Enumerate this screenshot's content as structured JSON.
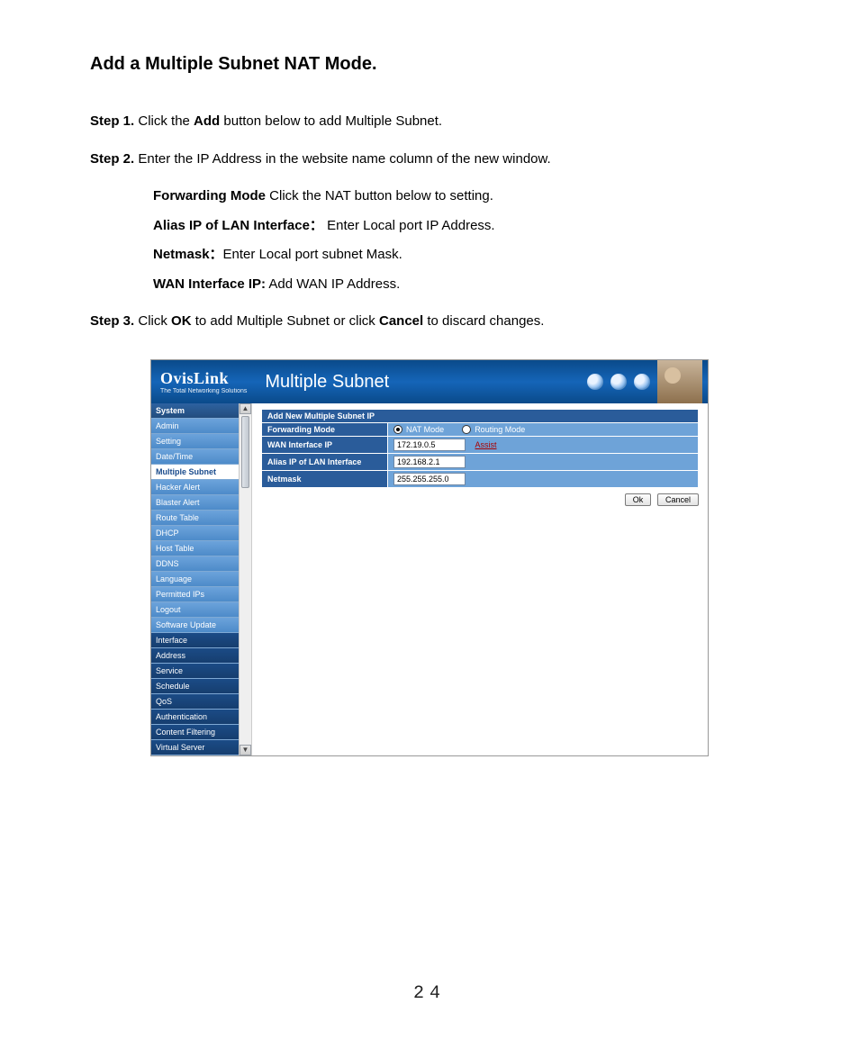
{
  "doc": {
    "title": "Add a Multiple Subnet NAT Mode.",
    "step1_label": "Step 1.",
    "step1_pre": " Click the ",
    "step1_bold": "Add",
    "step1_post": " button below to add Multiple Subnet.",
    "step2_label": "Step 2.",
    "step2_text": " Enter the IP Address in the website name column of the new window.",
    "sub_fwd_b": "Forwarding Mode",
    "sub_fwd_t": " Click the NAT button below to setting.",
    "sub_alias_b": "Alias IP of LAN Interface：",
    "sub_alias_t": "   Enter Local port IP Address.",
    "sub_net_b": "Netmask：",
    "sub_net_t": "Enter Local port subnet Mask.",
    "sub_wan_b": "WAN Interface IP:",
    "sub_wan_t": " Add WAN IP Address.",
    "step3_label": "Step 3.",
    "step3_pre": " Click ",
    "step3_b1": "OK",
    "step3_mid": " to add Multiple Subnet or click ",
    "step3_b2": "Cancel",
    "step3_post": " to discard changes.",
    "page_number": "24"
  },
  "app": {
    "brand": "OvisLink",
    "tagline": "The Total Networking Solutions",
    "page_title": "Multiple Subnet"
  },
  "nav": {
    "system": "System",
    "items_a": [
      "Admin",
      "Setting",
      "Date/Time"
    ],
    "selected": "Multiple Subnet",
    "items_b": [
      "Hacker Alert",
      "Blaster Alert",
      "Route Table",
      "DHCP",
      "Host Table",
      "DDNS",
      "Language",
      "Permitted IPs",
      "Logout",
      "Software Update"
    ],
    "cats": [
      "Interface",
      "Address",
      "Service",
      "Schedule",
      "QoS",
      "Authentication",
      "Content Filtering",
      "Virtual Server"
    ]
  },
  "form": {
    "header": "Add New Multiple Subnet IP",
    "fwd_label": "Forwarding Mode",
    "nat_mode": "NAT Mode",
    "routing_mode": "Routing Mode",
    "wan_label": "WAN Interface IP",
    "wan_value": "172.19.0.5",
    "assist": "Assist",
    "alias_label": "Alias IP of LAN Interface",
    "alias_value": "192.168.2.1",
    "netmask_label": "Netmask",
    "netmask_value": "255.255.255.0",
    "ok": "Ok",
    "cancel": "Cancel"
  }
}
